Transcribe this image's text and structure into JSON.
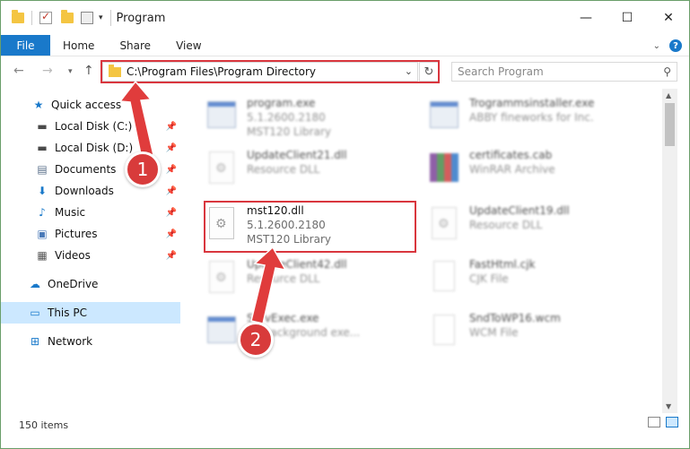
{
  "window": {
    "title": "Program",
    "controls": {
      "minimize": "—",
      "maximize": "☐",
      "close": "✕"
    }
  },
  "ribbon": {
    "tabs": [
      "File",
      "Home",
      "Share",
      "View"
    ],
    "help": "?"
  },
  "address": {
    "path": "C:\\Program Files\\Program Directory",
    "search_placeholder": "Search Program"
  },
  "nav": {
    "items": [
      {
        "label": "Quick access"
      },
      {
        "label": "Local Disk (C:)"
      },
      {
        "label": "Local Disk (D:)"
      },
      {
        "label": "Documents"
      },
      {
        "label": "Downloads"
      },
      {
        "label": "Music"
      },
      {
        "label": "Pictures"
      },
      {
        "label": "Videos"
      },
      {
        "label": "OneDrive"
      },
      {
        "label": "This PC"
      },
      {
        "label": "Network"
      }
    ]
  },
  "files": [
    {
      "name": "program.exe",
      "line2": "5.1.2600.2180",
      "line3": "MST120 Library",
      "icon": "exe-icon"
    },
    {
      "name": "Trogrammsinstaller.exe",
      "line2": "ABBY fineworks for Inc.",
      "line3": "",
      "icon": "exe-icon"
    },
    {
      "name": "UpdateClient21.dll",
      "line2": "Resource DLL",
      "line3": "",
      "icon": "dll-icon"
    },
    {
      "name": "certificates.cab",
      "line2": "WinRAR Archive",
      "line3": "",
      "icon": "rar-icon"
    },
    {
      "name": "mst120.dll",
      "line2": "5.1.2600.2180",
      "line3": "MST120 Library",
      "icon": "dll-icon"
    },
    {
      "name": "UpdateClient19.dll",
      "line2": "Resource DLL",
      "line3": "",
      "icon": "dll-icon"
    },
    {
      "name": "UpdateClient42.dll",
      "line2": "Resource DLL",
      "line3": "",
      "icon": "dll-icon"
    },
    {
      "name": "FastHtml.cjk",
      "line2": "CJK File",
      "line3": "",
      "icon": "file-icon"
    },
    {
      "name": "ServExec.exe",
      "line2": "EY background exe...",
      "line3": "",
      "icon": "exe-icon"
    },
    {
      "name": "SndToWP16.wcm",
      "line2": "WCM File",
      "line3": "",
      "icon": "file-icon"
    }
  ],
  "status": {
    "items_count": "150 items"
  },
  "annotations": {
    "badge1": "1",
    "badge2": "2"
  },
  "colors": {
    "accent": "#1979ca",
    "highlight": "#d9363e",
    "selected": "#cce8ff"
  }
}
